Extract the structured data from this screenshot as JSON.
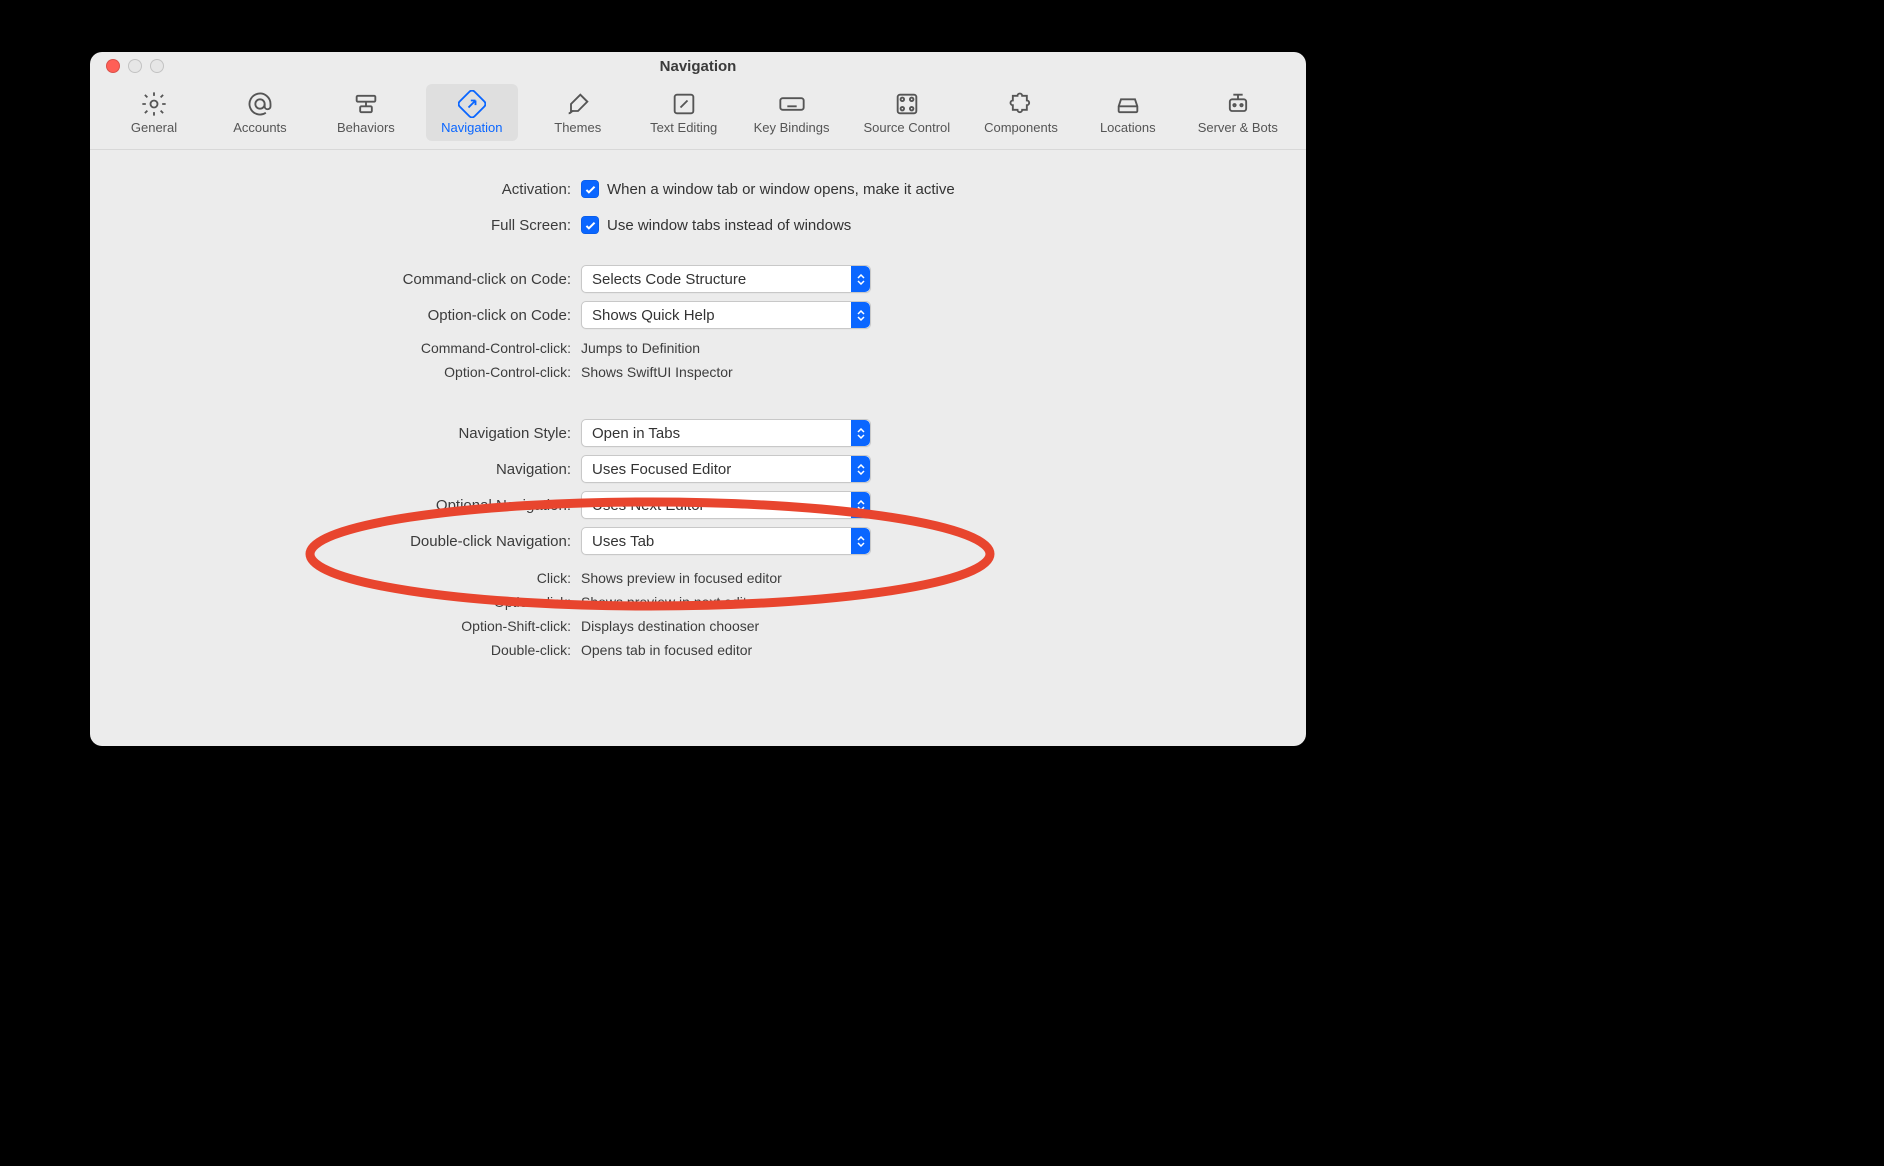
{
  "window": {
    "title": "Navigation"
  },
  "toolbar": {
    "tabs": [
      {
        "id": "general",
        "label": "General"
      },
      {
        "id": "accounts",
        "label": "Accounts"
      },
      {
        "id": "behaviors",
        "label": "Behaviors"
      },
      {
        "id": "navigation",
        "label": "Navigation",
        "selected": true
      },
      {
        "id": "themes",
        "label": "Themes"
      },
      {
        "id": "text-editing",
        "label": "Text Editing"
      },
      {
        "id": "key-bindings",
        "label": "Key Bindings"
      },
      {
        "id": "source-control",
        "label": "Source Control"
      },
      {
        "id": "components",
        "label": "Components"
      },
      {
        "id": "locations",
        "label": "Locations"
      },
      {
        "id": "server-bots",
        "label": "Server & Bots"
      }
    ]
  },
  "settings": {
    "activation": {
      "label": "Activation:",
      "checkbox_label": "When a window tab or window opens, make it active",
      "checked": true
    },
    "full_screen": {
      "label": "Full Screen:",
      "checkbox_label": "Use window tabs instead of windows",
      "checked": true
    },
    "command_click_code": {
      "label": "Command-click on Code:",
      "value": "Selects Code Structure"
    },
    "option_click_code": {
      "label": "Option-click on Code:",
      "value": "Shows Quick Help"
    },
    "command_control_click": {
      "label": "Command-Control-click:",
      "value": "Jumps to Definition"
    },
    "option_control_click": {
      "label": "Option-Control-click:",
      "value": "Shows SwiftUI Inspector"
    },
    "navigation_style": {
      "label": "Navigation Style:",
      "value": "Open in Tabs"
    },
    "navigation": {
      "label": "Navigation:",
      "value": "Uses Focused Editor"
    },
    "optional_navigation": {
      "label": "Optional Navigation:",
      "value": "Uses Next Editor"
    },
    "double_click_navigation": {
      "label": "Double-click Navigation:",
      "value": "Uses Tab"
    },
    "click": {
      "label": "Click:",
      "value": "Shows preview in focused editor"
    },
    "option_click": {
      "label": "Option-click:",
      "value": "Shows preview in next editor"
    },
    "option_shift_click": {
      "label": "Option-Shift-click:",
      "value": "Displays destination chooser"
    },
    "double_click": {
      "label": "Double-click:",
      "value": "Opens tab in focused editor"
    }
  },
  "annotation": {
    "highlight": "Optional Navigation"
  }
}
